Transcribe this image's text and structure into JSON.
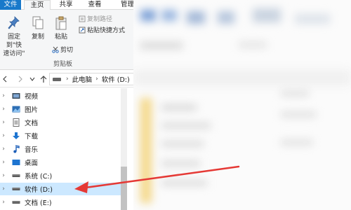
{
  "ribbon_tabs": {
    "file": "文件",
    "home": "主页",
    "share": "共享",
    "view": "查看",
    "manage": "管理"
  },
  "clipboard": {
    "pin_label": "固定到\"快速访问\"",
    "pin_line1": "固定到\"快",
    "pin_line2": "速访问\"",
    "copy": "复制",
    "paste": "粘贴",
    "copy_path": "复制路径",
    "paste_shortcut": "粘贴快捷方式",
    "cut": "剪切",
    "group_label": "剪贴板"
  },
  "address": {
    "segments": [
      "此电脑",
      "软件 (D:)"
    ]
  },
  "nav_tree": [
    {
      "label": "视频",
      "icon": "video-icon"
    },
    {
      "label": "图片",
      "icon": "pictures-icon"
    },
    {
      "label": "文档",
      "icon": "documents-icon"
    },
    {
      "label": "下载",
      "icon": "downloads-icon"
    },
    {
      "label": "音乐",
      "icon": "music-icon"
    },
    {
      "label": "桌面",
      "icon": "desktop-icon"
    },
    {
      "label": "系统 (C:)",
      "icon": "drive-icon"
    },
    {
      "label": "软件 (D:)",
      "icon": "drive-icon",
      "selected": true
    },
    {
      "label": "文档 (E:)",
      "icon": "drive-icon"
    }
  ],
  "colors": {
    "accent": "#1979ca",
    "selected_row": "#cce8ff",
    "annotation_arrow": "#e53935"
  }
}
